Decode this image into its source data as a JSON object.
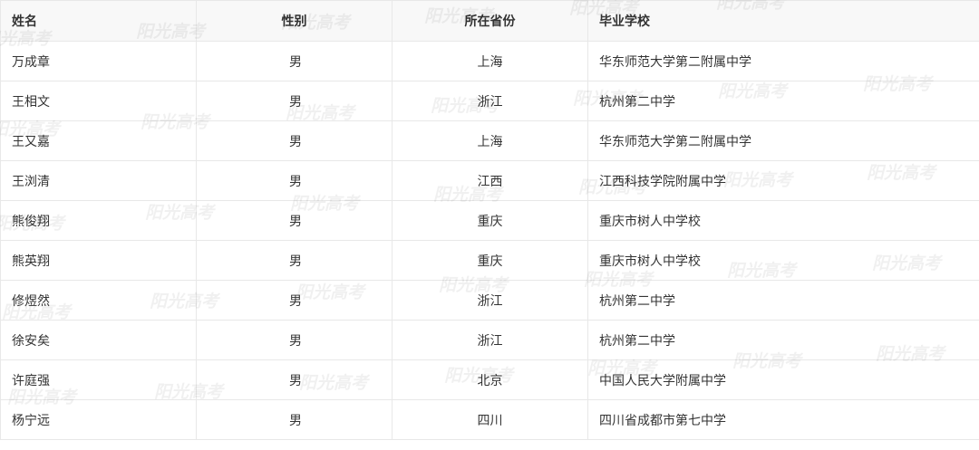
{
  "table": {
    "headers": [
      "姓名",
      "性别",
      "所在省份",
      "毕业学校"
    ],
    "rows": [
      [
        "万成章",
        "男",
        "上海",
        "华东师范大学第二附属中学"
      ],
      [
        "王相文",
        "男",
        "浙江",
        "杭州第二中学"
      ],
      [
        "王又嘉",
        "男",
        "上海",
        "华东师范大学第二附属中学"
      ],
      [
        "王浏清",
        "男",
        "江西",
        "江西科技学院附属中学"
      ],
      [
        "熊俊翔",
        "男",
        "重庆",
        "重庆市树人中学校"
      ],
      [
        "熊英翔",
        "男",
        "重庆",
        "重庆市树人中学校"
      ],
      [
        "修煜然",
        "男",
        "浙江",
        "杭州第二中学"
      ],
      [
        "徐安矣",
        "男",
        "浙江",
        "杭州第二中学"
      ],
      [
        "许庭强",
        "男",
        "北京",
        "中国人民大学附属中学"
      ],
      [
        "杨宁远",
        "男",
        "四川",
        "四川省成都市第七中学"
      ]
    ]
  },
  "watermark": {
    "text": "阳光高考"
  }
}
